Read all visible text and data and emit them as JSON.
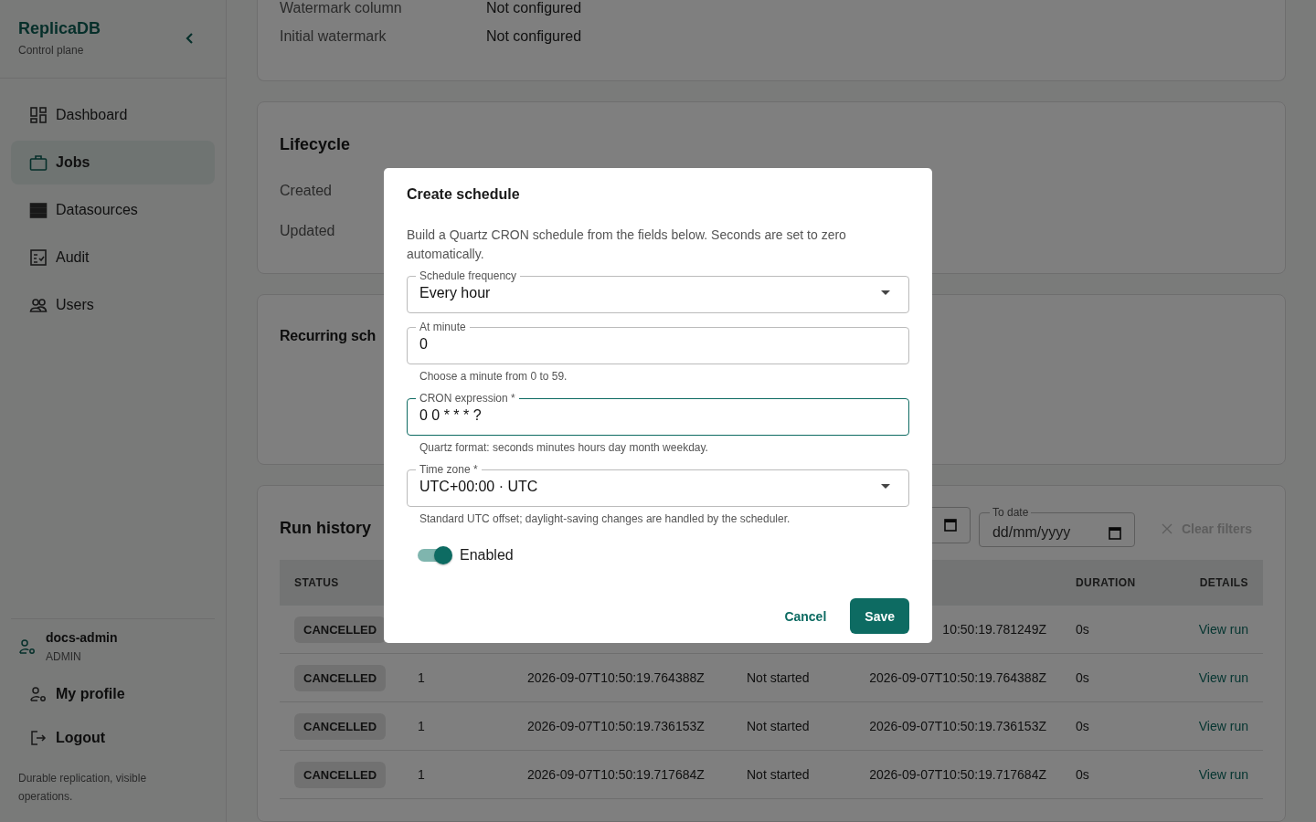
{
  "sidebar": {
    "brand": "ReplicaDB",
    "subtitle": "Control plane",
    "items": [
      {
        "label": "Dashboard",
        "selected": false
      },
      {
        "label": "Jobs",
        "selected": true
      },
      {
        "label": "Datasources",
        "selected": false
      },
      {
        "label": "Audit",
        "selected": false
      },
      {
        "label": "Users",
        "selected": false
      }
    ],
    "user": {
      "name": "docs-admin",
      "role": "ADMIN"
    },
    "account_items": [
      {
        "label": "My profile"
      },
      {
        "label": "Logout"
      }
    ],
    "footer": "Durable replication, visible operations."
  },
  "details_card": {
    "rows": [
      {
        "label": "Watermark column",
        "value": "Not configured"
      },
      {
        "label": "Initial watermark",
        "value": "Not configured"
      }
    ]
  },
  "lifecycle_card": {
    "title": "Lifecycle",
    "rows": [
      {
        "label": "Created"
      },
      {
        "label": "Updated"
      }
    ]
  },
  "schedules_card": {
    "title": "Recurring sch"
  },
  "run_history": {
    "title": "Run history",
    "filters": [
      {
        "kind": "date"
      },
      {
        "kind": "date",
        "label": "To date",
        "placeholder": "dd/mm/yyyy"
      }
    ],
    "clear_filters": {
      "label": "Clear filters",
      "disabled": true
    },
    "columns": {
      "status": "STATUS",
      "duration": "DURATION",
      "details": "DETAILS"
    },
    "rows": [
      {
        "status": "CANCELLED",
        "finished": "10:50:19.781249Z",
        "duration": "0s",
        "link": "View run"
      },
      {
        "status": "CANCELLED",
        "attempt": "1",
        "started": "2026-09-07T10:50:19.764388Z",
        "state": "Not started",
        "finished": "2026-09-07T10:50:19.764388Z",
        "duration": "0s",
        "link": "View run"
      },
      {
        "status": "CANCELLED",
        "attempt": "1",
        "started": "2026-09-07T10:50:19.736153Z",
        "state": "Not started",
        "finished": "2026-09-07T10:50:19.736153Z",
        "duration": "0s",
        "link": "View run"
      },
      {
        "status": "CANCELLED",
        "attempt": "1",
        "started": "2026-09-07T10:50:19.717684Z",
        "state": "Not started",
        "finished": "2026-09-07T10:50:19.717684Z",
        "duration": "0s",
        "link": "View run"
      }
    ]
  },
  "dialog": {
    "title": "Create schedule",
    "description": "Build a Quartz CRON schedule from the fields below. Seconds are set to zero automatically.",
    "fields": [
      {
        "kind": "select",
        "label": "Schedule frequency",
        "value": "Every hour",
        "focused": false
      },
      {
        "kind": "text",
        "label": "At minute",
        "value": "0",
        "helper": "Choose a minute from 0 to 59.",
        "focused": false
      },
      {
        "kind": "text",
        "label": "CRON expression *",
        "value": "0 0 * * * ?",
        "helper": "Quartz format: seconds minutes hours day month weekday.",
        "focused": true
      },
      {
        "kind": "select",
        "label": "Time zone *",
        "value": "UTC+00:00 · UTC",
        "helper": "Standard UTC offset; daylight-saving changes are handled by the scheduler.",
        "focused": false
      }
    ],
    "toggle": {
      "label": "Enabled",
      "on": true
    },
    "buttons": [
      {
        "label": "Cancel",
        "kind": "text"
      },
      {
        "label": "Save",
        "kind": "primary"
      }
    ]
  }
}
